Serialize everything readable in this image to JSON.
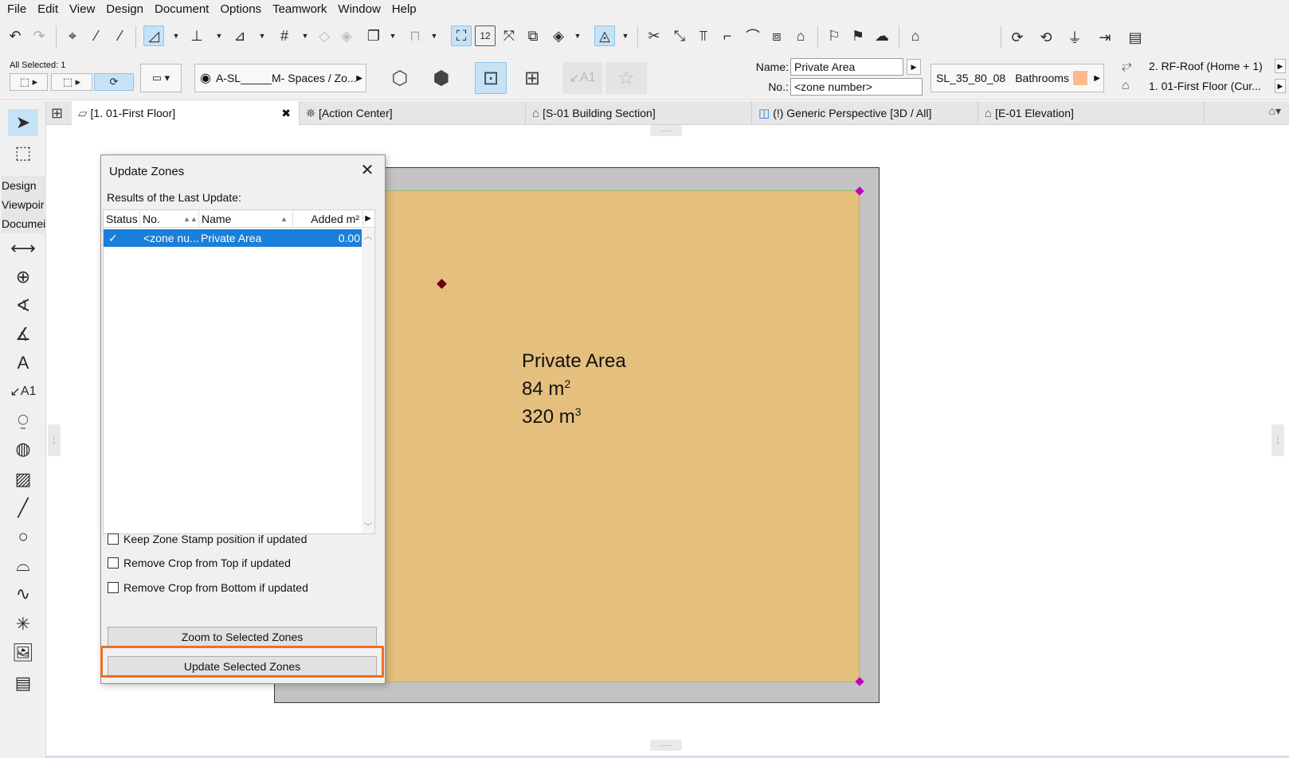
{
  "menu": [
    "File",
    "Edit",
    "View",
    "Design",
    "Document",
    "Options",
    "Teamwork",
    "Window",
    "Help"
  ],
  "info_box": {
    "selection_label": "All Selected: 1",
    "layer": "A-SL_____M- Spaces / Zo...",
    "name_label": "Name:",
    "name_value": "Private Area",
    "number_label": "No.:",
    "number_value": "<zone number>",
    "zone_category_code": "SL_35_80_08",
    "zone_category_name": "Bathrooms",
    "zone_category_color": "#ffb98a",
    "top_story": "2. RF-Roof (Home + 1)",
    "home_story": "1. 01-First Floor (Cur...",
    "label_tool": "A1"
  },
  "tabs": [
    {
      "label": "[1. 01-First Floor]",
      "icon": "floor-plan-icon",
      "active": true
    },
    {
      "label": "[Action Center]",
      "icon": "action-center-icon",
      "active": false
    },
    {
      "label": "[S-01 Building Section]",
      "icon": "section-icon",
      "active": false
    },
    {
      "label": "(!) Generic Perspective [3D / All]",
      "icon": "3d-icon",
      "active": false
    },
    {
      "label": "[E-01 Elevation]",
      "icon": "elevation-icon",
      "active": false
    }
  ],
  "toolbox": {
    "design": "Design",
    "viewpoint": "Viewpoir",
    "document": "Documei",
    "label_text": "A1"
  },
  "zone_stamp": {
    "name": "Private Area",
    "area": "84 m",
    "area_exp": "2",
    "volume": "320 m",
    "volume_exp": "3"
  },
  "dialog": {
    "title": "Update Zones",
    "subtitle": "Results of the Last Update:",
    "columns": [
      "Status",
      "No.",
      "Name",
      "Added m²"
    ],
    "rows": [
      {
        "status": "✓",
        "number": "<zone nu...",
        "name": "Private Area",
        "added": "0.00"
      }
    ],
    "checkboxes": [
      {
        "label": "Keep Zone Stamp position if updated",
        "checked": false
      },
      {
        "label": "Remove Crop from Top if updated",
        "checked": false
      },
      {
        "label": "Remove Crop from Bottom if updated",
        "checked": false
      }
    ],
    "zoom_button": "Zoom to Selected Zones",
    "update_button": "Update Selected Zones"
  },
  "colors": {
    "highlight": "#ee6f24",
    "zone_fill": "#e4bf7d",
    "selection": "#1a7fd8"
  }
}
